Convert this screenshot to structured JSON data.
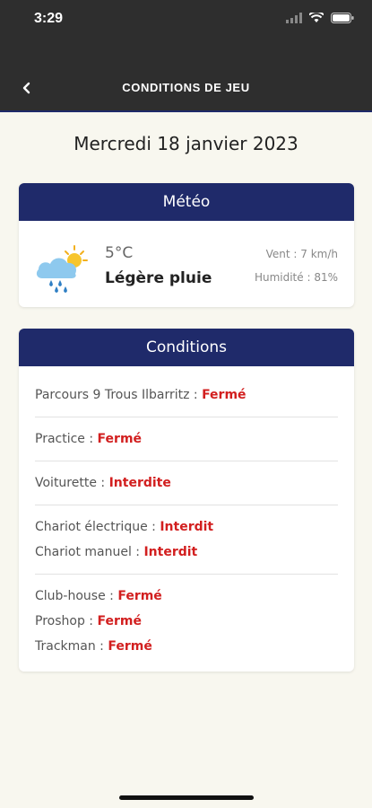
{
  "status_bar": {
    "time": "3:29"
  },
  "nav": {
    "title": "CONDITIONS DE JEU"
  },
  "date": "Mercredi 18 janvier 2023",
  "meteo": {
    "header": "Météo",
    "temperature": "5°C",
    "condition": "Légère pluie",
    "wind": "Vent : 7 km/h",
    "humidity": "Humidité : 81%",
    "icon": "rain-cloud-sun-icon"
  },
  "conditions": {
    "header": "Conditions",
    "groups": [
      [
        {
          "label": "Parcours 9 Trous Ilbarritz",
          "value": "Fermé"
        }
      ],
      [
        {
          "label": "Practice",
          "value": "Fermé"
        }
      ],
      [
        {
          "label": "Voiturette",
          "value": "Interdite"
        }
      ],
      [
        {
          "label": "Chariot électrique",
          "value": "Interdit"
        },
        {
          "label": "Chariot manuel",
          "value": "Interdit"
        }
      ],
      [
        {
          "label": "Club-house",
          "value": "Fermé"
        },
        {
          "label": "Proshop",
          "value": "Fermé"
        },
        {
          "label": "Trackman",
          "value": "Fermé"
        }
      ]
    ]
  },
  "colors": {
    "navy": "#1f2a6a",
    "status_red": "#d21f1f",
    "background": "#f8f7ef",
    "topbar": "#2e2e2e"
  }
}
